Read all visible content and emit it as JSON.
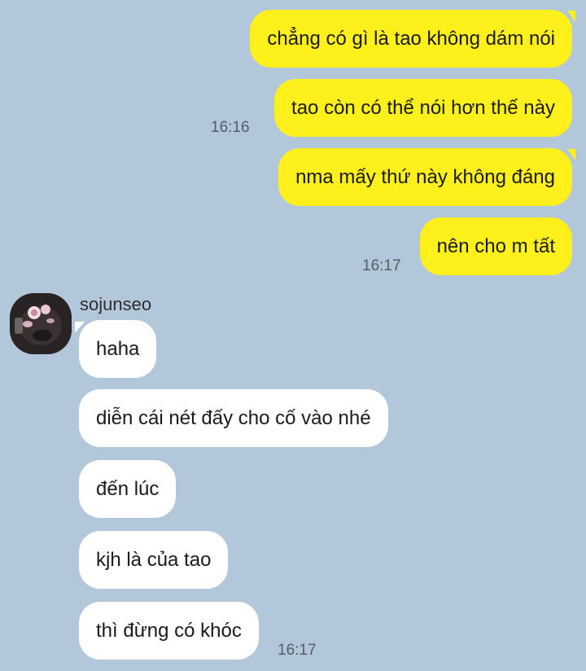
{
  "outgoing": {
    "messages": [
      "chẳng có gì là tao không dám nói",
      "tao còn có thể nói hơn thế này",
      "nma mấy thứ này không đáng",
      "nên cho m tất"
    ],
    "time_1": "16:16",
    "time_2": "16:17"
  },
  "incoming": {
    "sender": "sojunseo",
    "messages": [
      "haha",
      "diễn cái nét đấy cho cố vào nhé",
      "đến lúc",
      "kjh là của tao",
      "thì đừng có khóc"
    ],
    "time": "16:17"
  },
  "colors": {
    "background": "#b2c7d9",
    "my_bubble": "#fef01b",
    "their_bubble": "#ffffff"
  }
}
